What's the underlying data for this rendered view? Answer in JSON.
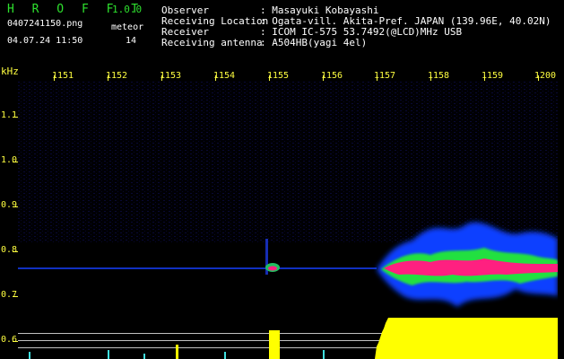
{
  "header": {
    "app_name": "H R O F F T",
    "version": "1.0.0",
    "filename": "0407241150.png",
    "datetime": "04.07.24 11:50",
    "mode_label": "meteor",
    "count": "14"
  },
  "info": {
    "observer_label": "Observer",
    "observer_value": ": Masayuki Kobayashi",
    "location_label": "Receiving Location",
    "location_value": ": Ogata-vill. Akita-Pref. JAPAN (139.96E, 40.02N)",
    "receiver_label": "Receiver",
    "receiver_value": ": ICOM IC-575 53.7492(@LCD)MHz USB",
    "antenna_label": "Receiving antenna",
    "antenna_value": ": A504HB(yagi 4el)"
  },
  "axes": {
    "x_labels": [
      "1151",
      "1152",
      "1153",
      "1154",
      "1155",
      "1156",
      "1157",
      "1158",
      "1159",
      "1200"
    ],
    "y_unit": "kHz",
    "y_labels": [
      "1.1",
      "1.0",
      "0.9",
      "0.8",
      "0.7",
      "0.6"
    ]
  },
  "colors": {
    "background": "#000000",
    "axis_text": "#ffff40",
    "logo": "#2ee02e",
    "signal_core": "#ff2080",
    "signal_mid": "#20e040",
    "signal_low": "#1040ff",
    "signal_bar": "#ffff00"
  }
}
